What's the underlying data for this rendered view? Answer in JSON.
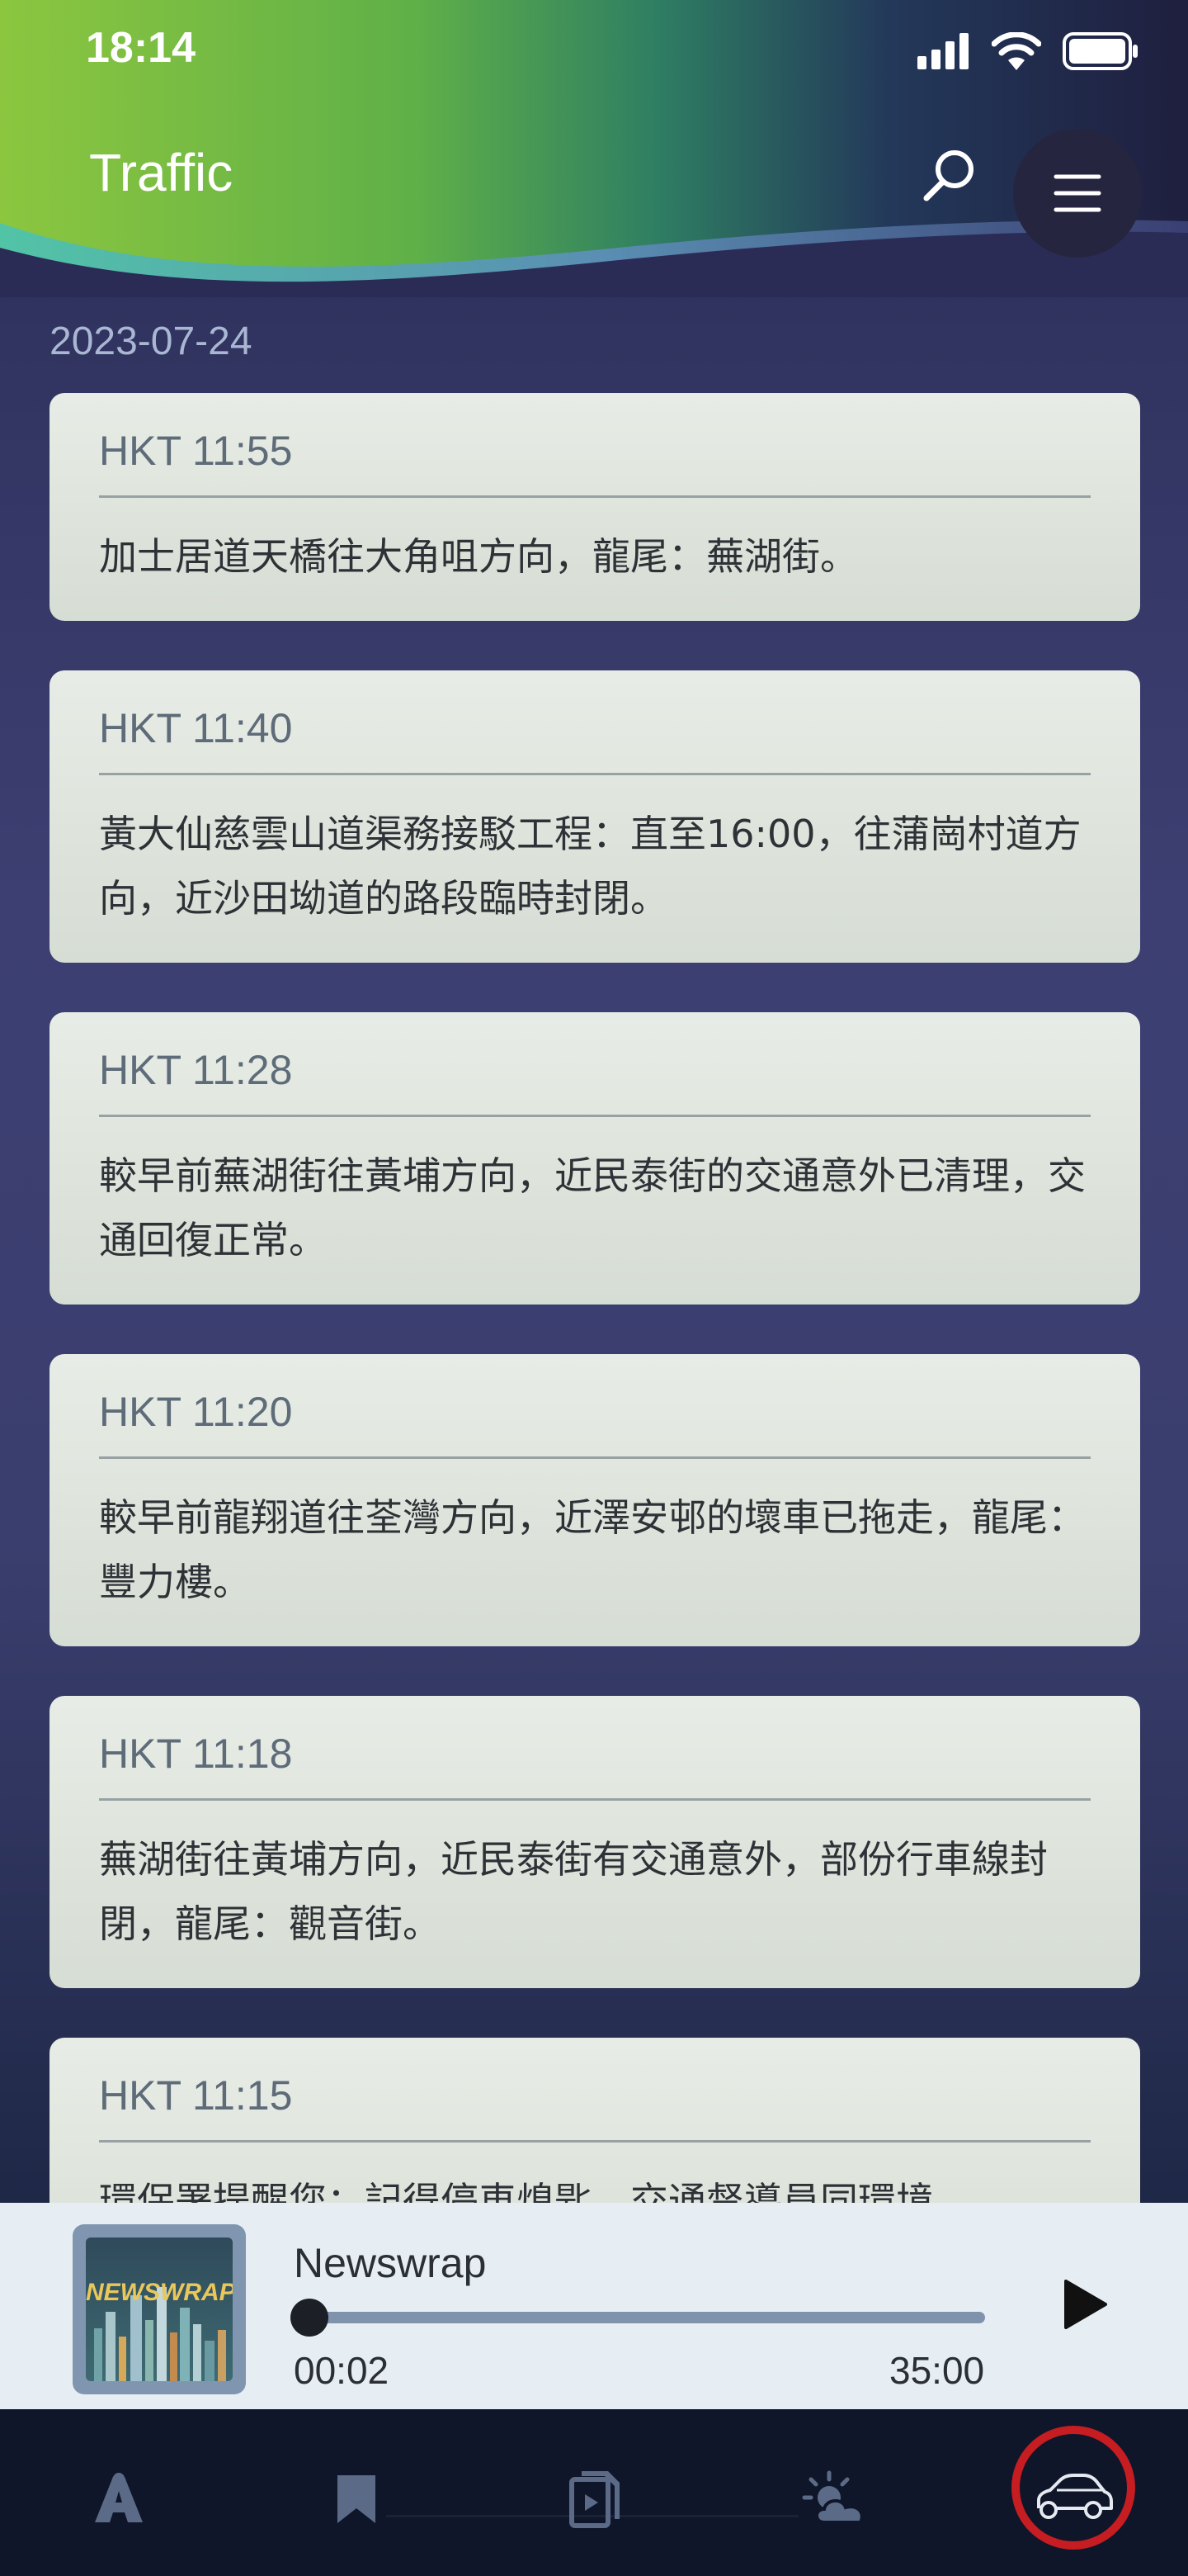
{
  "status_bar": {
    "time": "18:14",
    "icons": [
      "cellular-signal-icon",
      "wifi-icon",
      "battery-icon"
    ]
  },
  "header": {
    "title": "Traffic",
    "search_icon": "search-icon",
    "menu_icon": "hamburger-menu-icon"
  },
  "feed": {
    "date": "2023-07-24",
    "items": [
      {
        "time": "HKT 11:55",
        "text": "加士居道天橋往大角咀方向，龍尾：蕪湖街。"
      },
      {
        "time": "HKT 11:40",
        "text": "黃大仙慈雲山道渠務接駁工程：直至16:00，往蒲崗村道方向，近沙田坳道的路段臨時封閉。"
      },
      {
        "time": "HKT 11:28",
        "text": "較早前蕪湖街往黃埔方向，近民泰街的交通意外已清理，交通回復正常。"
      },
      {
        "time": "HKT 11:20",
        "text": "較早前龍翔道往荃灣方向，近澤安邨的壞車已拖走，龍尾：豐力樓。"
      },
      {
        "time": "HKT 11:18",
        "text": "蕪湖街往黃埔方向，近民泰街有交通意外，部份行車線封閉，龍尾：觀音街。"
      },
      {
        "time": "HKT 11:15",
        "text": "環保署提醒您：記得停車熄匙，交通督導員同環境"
      }
    ]
  },
  "player": {
    "thumbnail_logo": "NEWSWRAP",
    "title": "Newswrap",
    "elapsed": "00:02",
    "duration": "35:00",
    "progress_fraction": 0.001,
    "play_icon": "play-icon"
  },
  "bottom_nav": {
    "items": [
      {
        "icon": "home-a-icon",
        "active": false
      },
      {
        "icon": "bookmark-icon",
        "active": false
      },
      {
        "icon": "video-document-icon",
        "active": false
      },
      {
        "icon": "weather-icon",
        "active": false
      },
      {
        "icon": "car-icon",
        "active": true
      }
    ],
    "active_ring_color": "#c51d22"
  },
  "colors": {
    "header_green": "#8fc43c",
    "background": "#3a3e6e",
    "card": "#e3e8e2",
    "player_bg": "#e6eef4",
    "nav_bg": "#0f1629"
  }
}
